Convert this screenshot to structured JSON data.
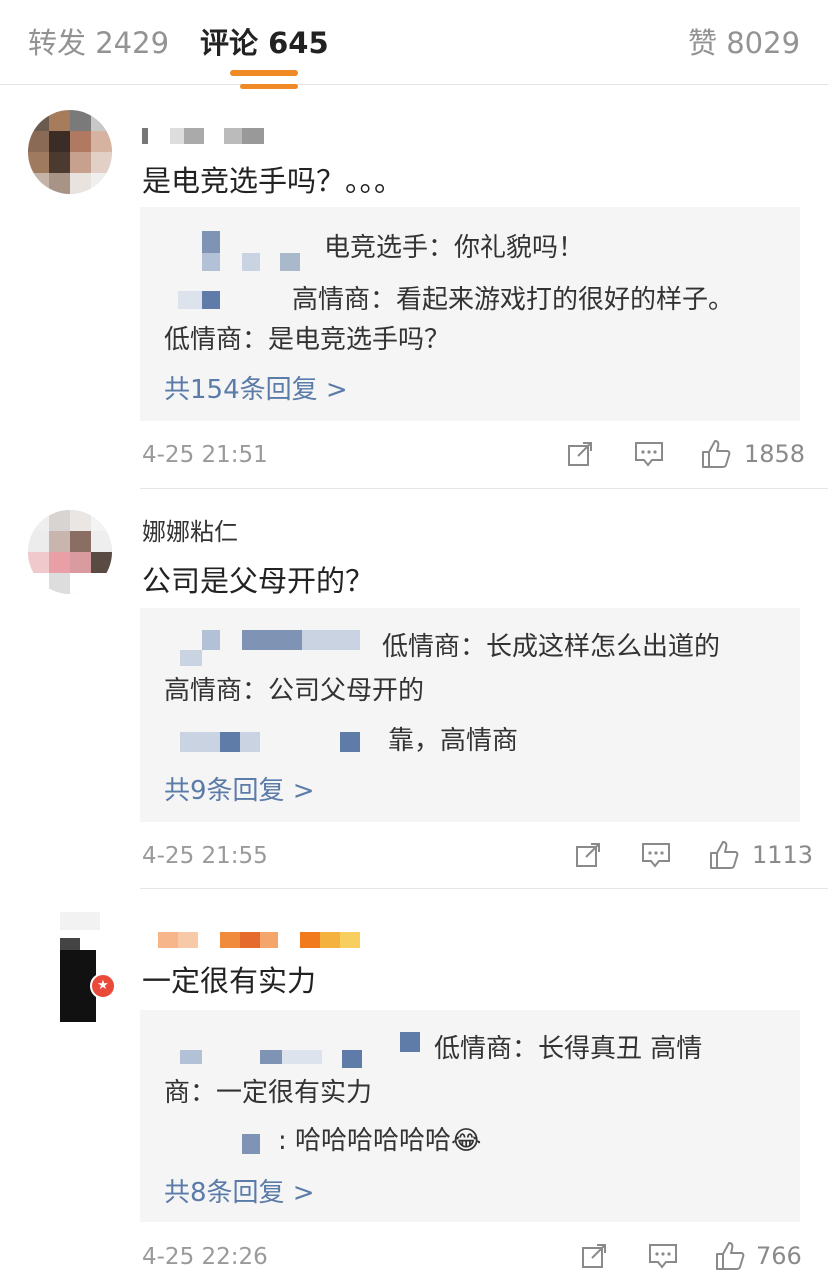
{
  "tabs": {
    "repost": "转发 2429",
    "comments": "评论 645",
    "likes": "赞 8029"
  },
  "comments": [
    {
      "username": "",
      "text": "是电竞选手吗？。。。",
      "replies": [
        "电竞选手：你礼貌吗！",
        "高情商：看起来游戏打的很好的样子。",
        "低情商：是电竞选手吗？"
      ],
      "reply_count": "共154条回复 >",
      "time": "4-25 21:51",
      "likes": "1858"
    },
    {
      "username": "娜娜粘仁",
      "text": "公司是父母开的？",
      "replies": [
        "低情商：长成这样怎么出道的",
        "高情商：公司父母开的",
        "靠，高情商"
      ],
      "reply_count": "共9条回复 >",
      "time": "4-25 21:55",
      "likes": "1113"
    },
    {
      "username": "",
      "text": "一定很有实力",
      "replies": [
        "低情商：长得真丑 高情",
        "商：一定很有实力",
        ": 哈哈哈哈哈哈😂"
      ],
      "reply_count": "共8条回复 >",
      "time": "4-25 22:26",
      "likes": "766"
    }
  ],
  "colors": {
    "accent": "#f08a24",
    "link": "#5b7ba8",
    "reply_bg": "#f5f5f5",
    "meta": "#9a9a9a"
  },
  "icons": [
    "share-icon",
    "comment-icon",
    "like-icon"
  ]
}
